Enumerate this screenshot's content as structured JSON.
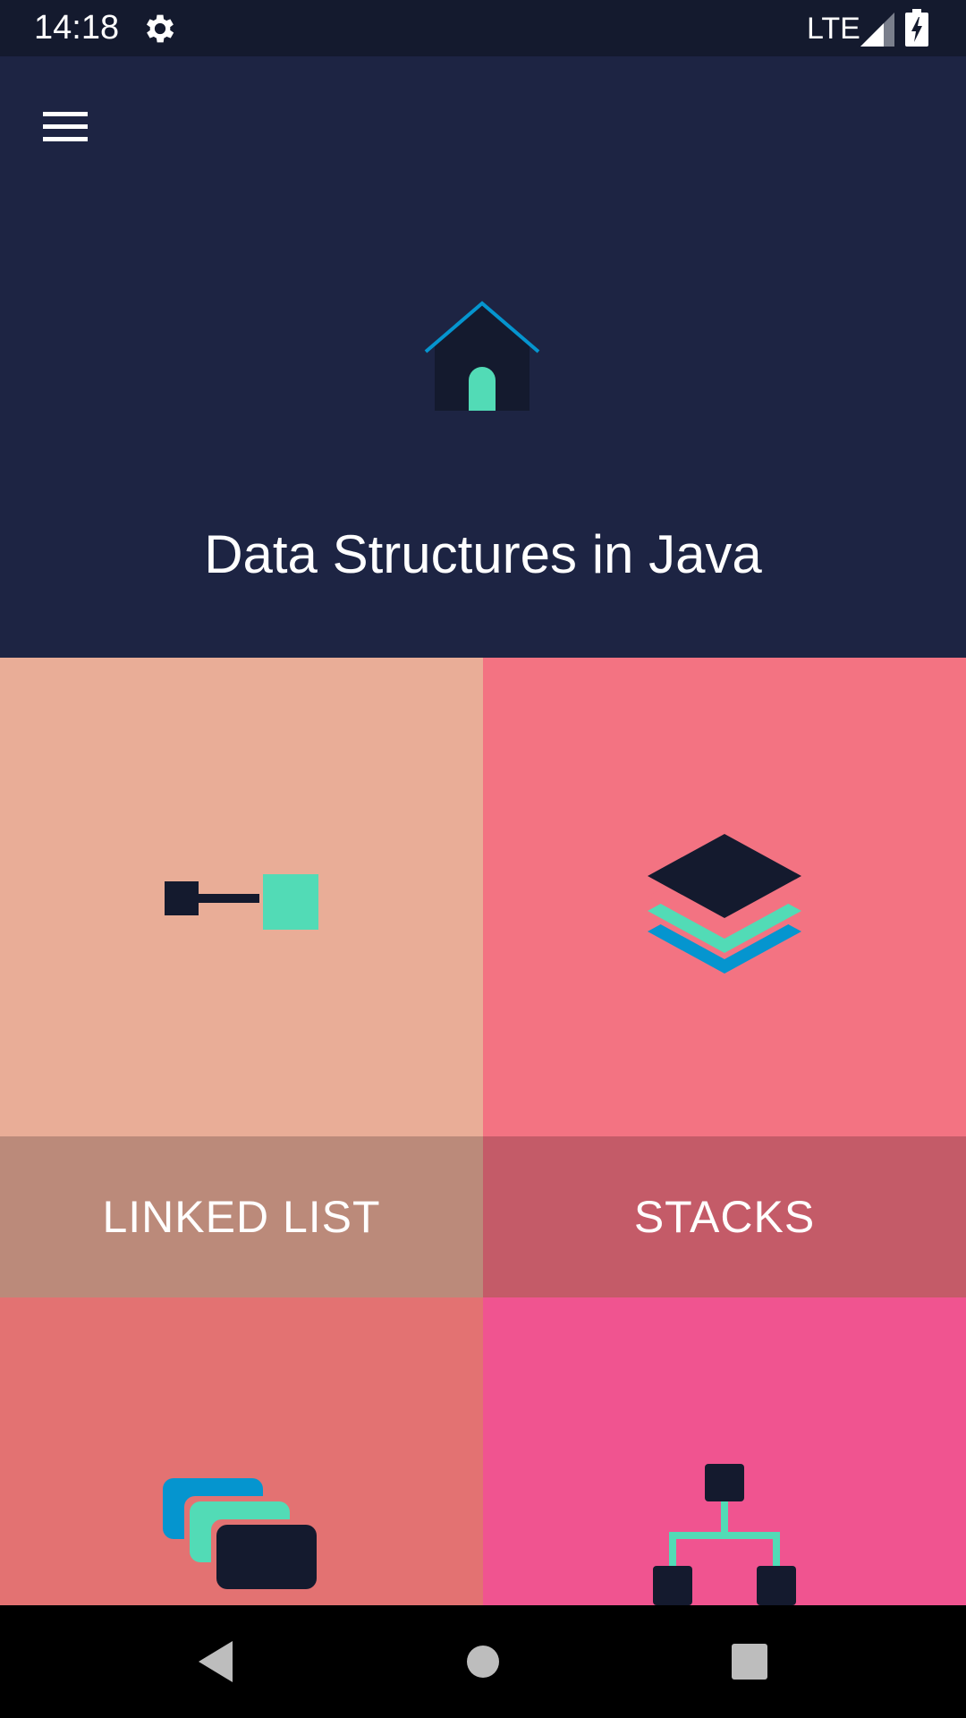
{
  "status_bar": {
    "time": "14:18",
    "network": "LTE",
    "icons": [
      "gear-icon",
      "signal-icon",
      "battery-charging-icon"
    ]
  },
  "header": {
    "menu_icon": "hamburger-menu-icon",
    "logo_icon": "home-icon",
    "title": "Data Structures in Java"
  },
  "tiles": [
    {
      "label": "LINKED LIST",
      "icon": "linked-list-icon",
      "bg": "#e9ad97",
      "band": "#bb8a7a"
    },
    {
      "label": "STACKS",
      "icon": "stack-layers-icon",
      "bg": "#f37382",
      "band": "#c45b68"
    },
    {
      "label": "",
      "icon": "queue-cards-icon",
      "bg": "#e37272"
    },
    {
      "label": "",
      "icon": "tree-icon",
      "bg": "#f05490"
    }
  ],
  "nav_bar": {
    "icons": [
      "back-icon",
      "home-circle-icon",
      "recents-icon"
    ]
  },
  "colors": {
    "status_bar": "#141a2e",
    "header": "#1d2443",
    "dark": "#141a2e",
    "mint": "#52dbb6",
    "blue": "#0595cf"
  }
}
